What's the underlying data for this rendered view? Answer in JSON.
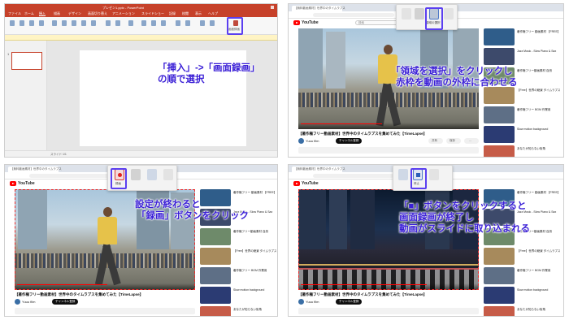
{
  "captions": {
    "p1": [
      "「挿入」->「画面録画」",
      "の順で選択"
    ],
    "p2": [
      "「領域を選択」をクリックし",
      "赤枠を動画の外枠に合わせる"
    ],
    "p3": [
      "設定が終わると",
      "「録画」ボタンをクリック"
    ],
    "p4": [
      "「■」ボタンをクリックすると",
      "画面録画が終了し",
      "動画がスライドに取り込まれる"
    ]
  },
  "powerpoint": {
    "window_title": "プレゼン1.pptx - PowerPoint",
    "tabs": [
      "ファイル",
      "ホーム",
      "挿入",
      "描画",
      "デザイン",
      "画面切り替え",
      "アニメーション",
      "スライドショー",
      "記録",
      "校閲",
      "表示",
      "ヘルプ"
    ],
    "highlighted_button": "画面録画",
    "slide_number": "1",
    "status": "スライド 1/1"
  },
  "youtube": {
    "tab_title": "【無料動画素材】世界中のタイムラプス",
    "logo_text": "YouTube",
    "search_placeholder": "検索",
    "video_title": "【著作権フリー動画素材】世界中のタイムラプスを集めてみた【TimeLapse】",
    "channel": "Yuuu film",
    "subscribe": "チャンネル登録",
    "actions": [
      "共有",
      "保存",
      "…"
    ],
    "recommendations": [
      "著作権フリー 動画素材 【FREE】NewYork City Night",
      "Jazz Music - Slow Piano & Sax",
      "著作権フリー動画素材 自然",
      "【Free】世界の絶景 タイムラプス",
      "著作権フリー BGM 作業用",
      "Slow motion background",
      "あなたが知らない街角"
    ]
  },
  "recorder": {
    "area_label": "領域の選択",
    "record_label": "録画",
    "stop_label": "停止",
    "pointer_label": "ポインター"
  },
  "colors": {
    "caption": "#3a1fd6",
    "highlight": "#5b3ff0",
    "powerpoint_accent": "#c6412a",
    "selection_dash": "#ee2a2a"
  }
}
